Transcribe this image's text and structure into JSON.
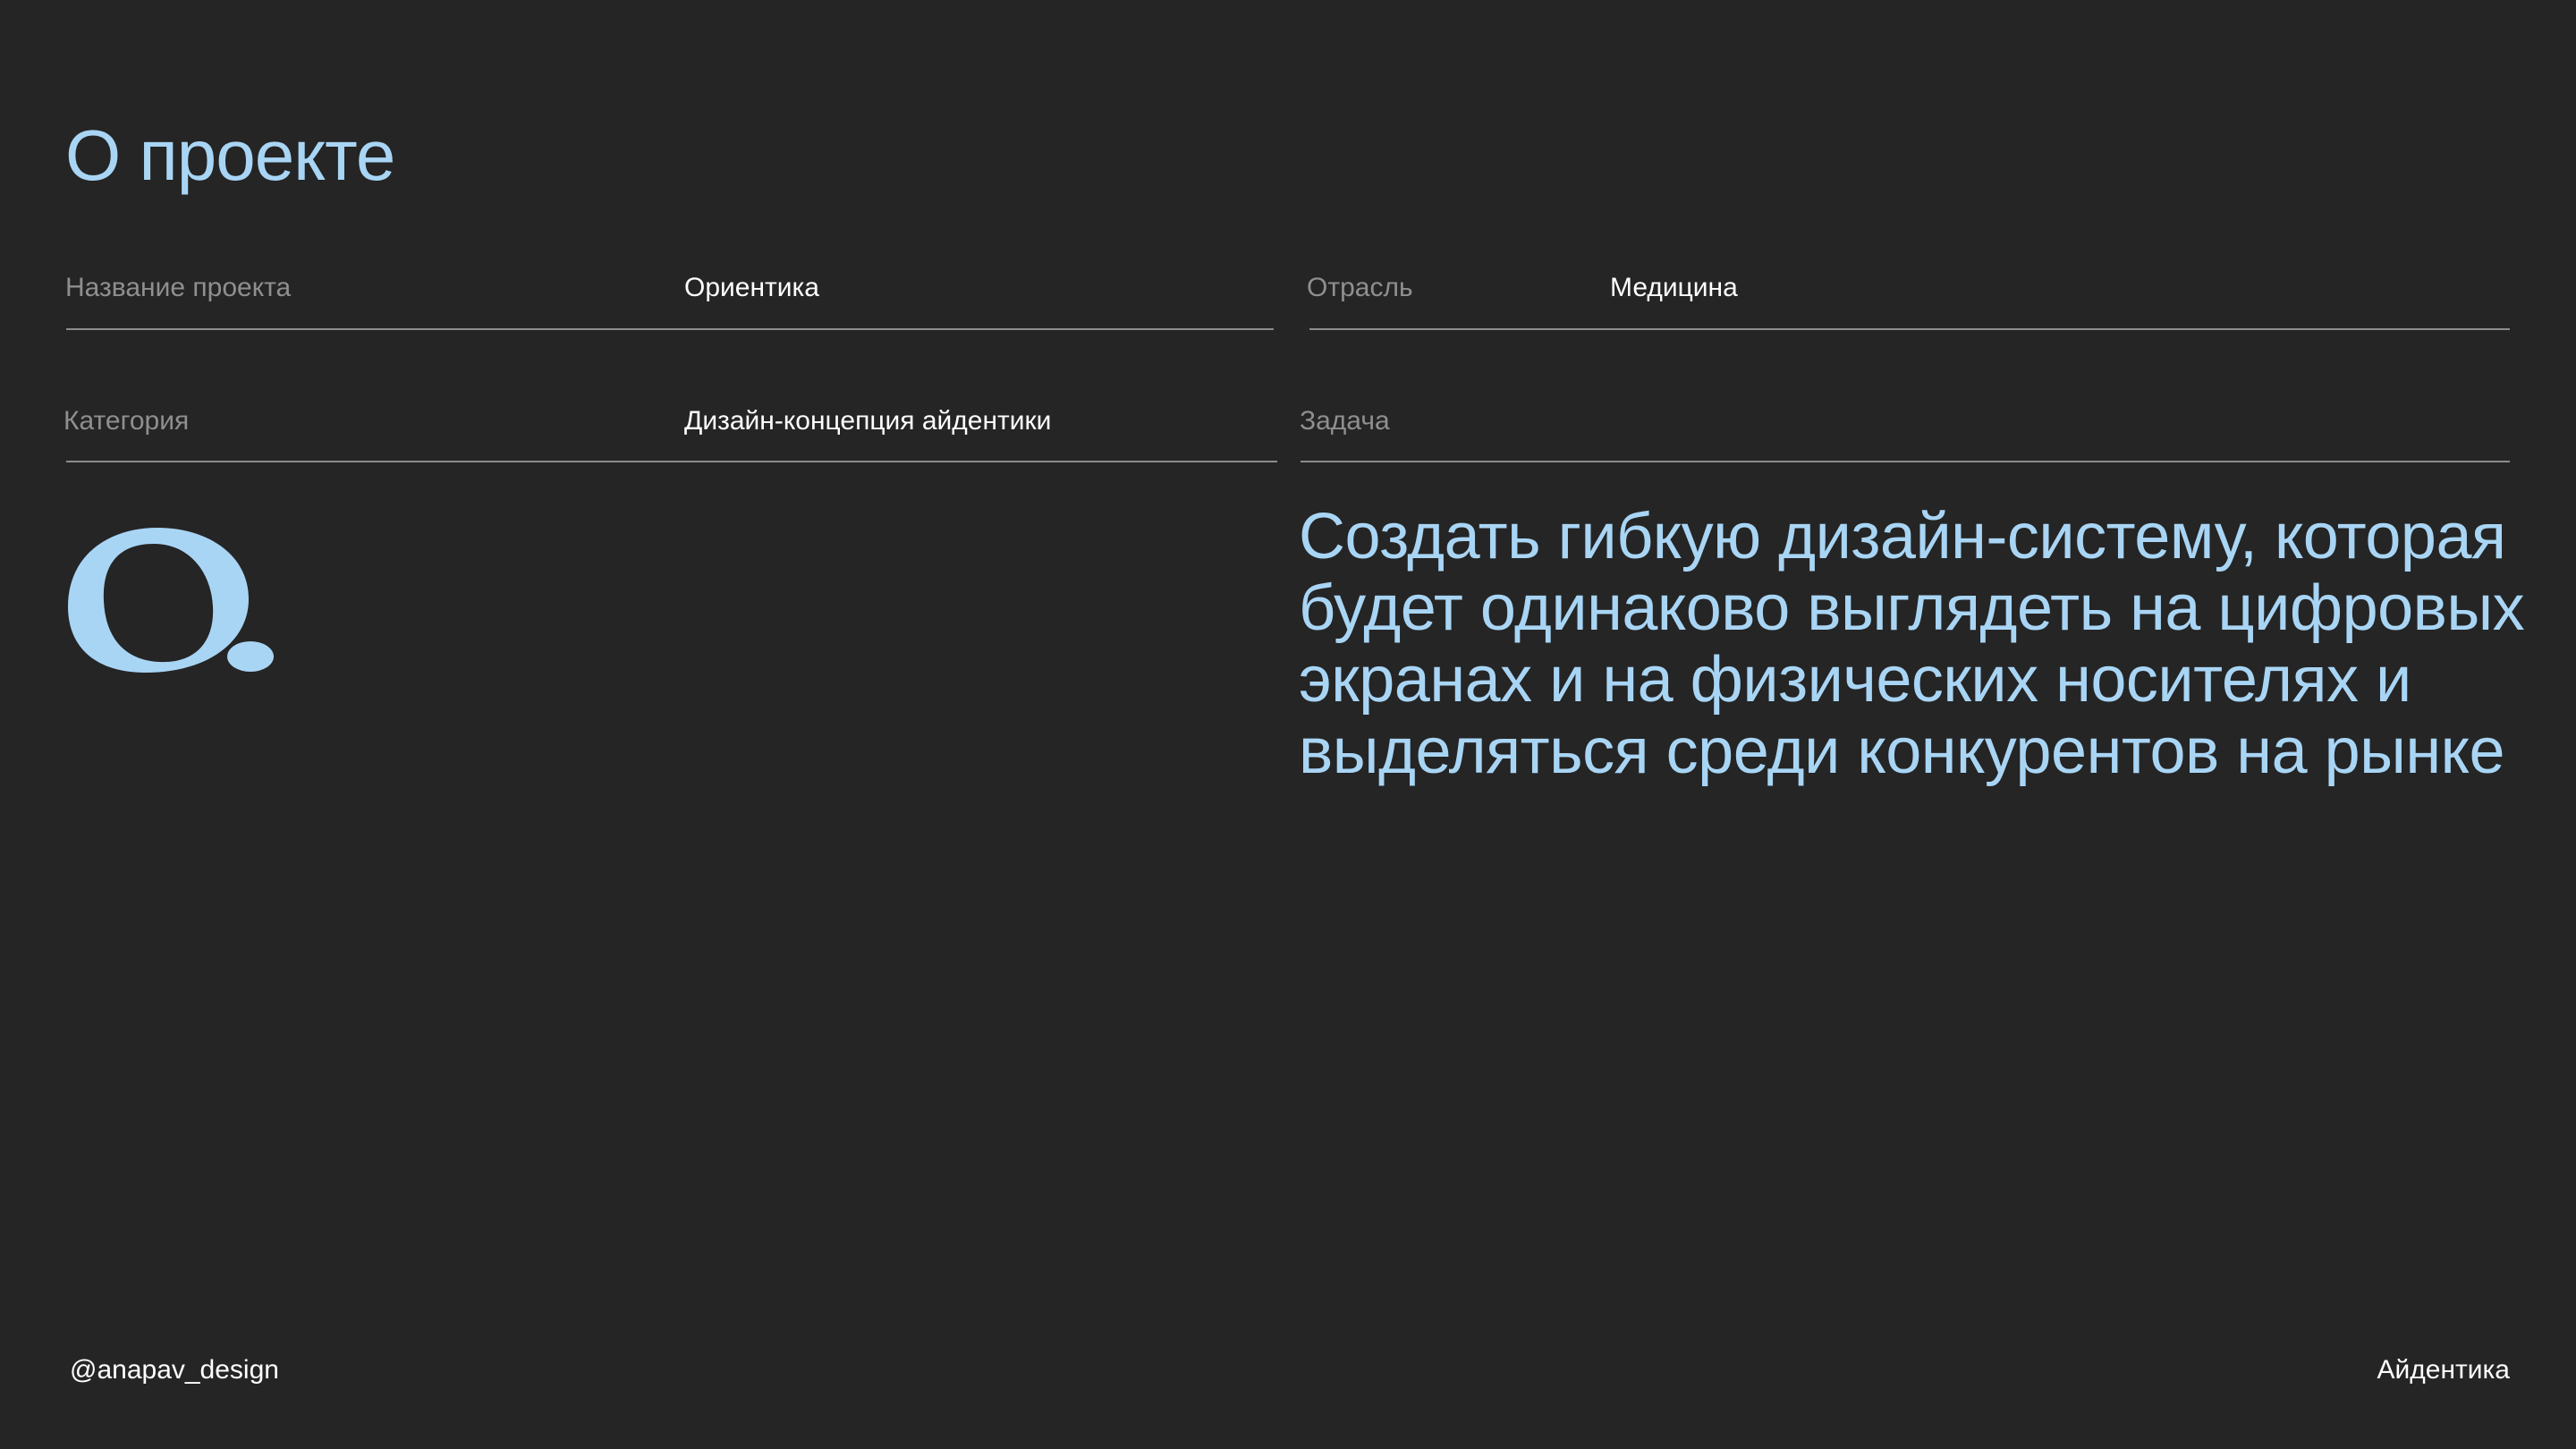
{
  "page": {
    "title": "О проекте"
  },
  "fields": {
    "project_name": {
      "label": "Название проекта",
      "value": "Ориентика"
    },
    "industry": {
      "label": "Отрасль",
      "value": "Медицина"
    },
    "category": {
      "label": "Категория",
      "value": "Дизайн-концепция айдентики"
    },
    "task": {
      "label": "Задача",
      "value": "Создать гибкую дизайн-систему, которая будет одинаково выглядеть на цифровых экранах и на физических носителях и выделяться среди конкурентов на рынке"
    }
  },
  "logo": {
    "icon": "orientika-logo-mark",
    "color": "#a9d5f5"
  },
  "footer": {
    "handle": "@anapav_design",
    "section": "Айдентика"
  },
  "colors": {
    "background": "#252525",
    "accent": "#a9d5f5",
    "label": "#8f8f8f",
    "rule": "#8c8c8c"
  }
}
